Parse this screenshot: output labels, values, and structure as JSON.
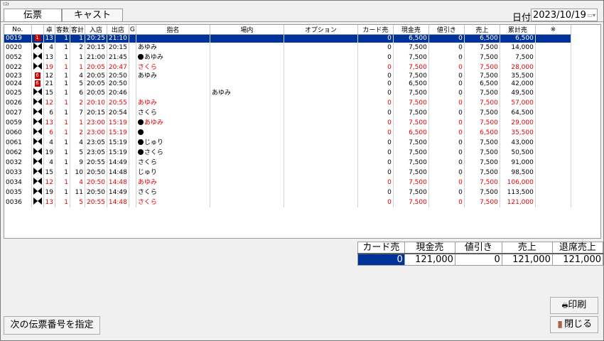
{
  "window": {
    "title": "ﾘｽﾄ"
  },
  "tabs": [
    {
      "label": "伝票"
    },
    {
      "label": "キャスト"
    }
  ],
  "date": {
    "label": "日付",
    "value": "2023/10/19",
    "dropdown_glyph": "▭▾"
  },
  "table": {
    "headers": [
      "No.",
      "",
      "卓",
      "客数",
      "客計",
      "入店",
      "出店",
      "G",
      "指名",
      "場内",
      "オプション",
      "カード売",
      "現金売",
      "値引き",
      "売上",
      "累計売",
      "※"
    ],
    "rows": [
      {
        "no": "0019",
        "tablenum": "13",
        "guests": "1",
        "total": "1",
        "in": "20:25",
        "out": "21:10",
        "g": "",
        "shimei": "",
        "jonai": "",
        "option": "",
        "card": "0",
        "cash": "6,500",
        "discount": "0",
        "sales": "6,500",
        "cumulative": "6,500",
        "note": "",
        "red": false,
        "selected": true,
        "flag": "1",
        "dot": false
      },
      {
        "no": "0020",
        "tablenum": "4",
        "guests": "1",
        "total": "2",
        "in": "20:15",
        "out": "20:15",
        "g": "",
        "shimei": "あゆみ",
        "jonai": "",
        "option": "",
        "card": "0",
        "cash": "7,500",
        "discount": "0",
        "sales": "7,500",
        "cumulative": "14,000",
        "note": "",
        "red": false,
        "selected": false,
        "flag": "",
        "dot": false
      },
      {
        "no": "0052",
        "tablenum": "13",
        "guests": "1",
        "total": "1",
        "in": "21:00",
        "out": "21:45",
        "g": "",
        "shimei": "あゆみ",
        "jonai": "",
        "option": "",
        "card": "0",
        "cash": "7,500",
        "discount": "0",
        "sales": "7,500",
        "cumulative": "7,500",
        "note": "",
        "red": false,
        "selected": false,
        "flag": "",
        "dot": true
      },
      {
        "no": "0022",
        "tablenum": "19",
        "guests": "1",
        "total": "1",
        "in": "20:05",
        "out": "20:47",
        "g": "",
        "shimei": "さくら",
        "jonai": "",
        "option": "",
        "card": "0",
        "cash": "7,500",
        "discount": "0",
        "sales": "7,500",
        "cumulative": "28,000",
        "note": "",
        "red": true,
        "selected": false,
        "flag": "",
        "dot": false
      },
      {
        "no": "0023",
        "tablenum": "12",
        "guests": "1",
        "total": "4",
        "in": "20:05",
        "out": "20:50",
        "g": "",
        "shimei": "あゆみ",
        "jonai": "",
        "option": "",
        "card": "0",
        "cash": "7,500",
        "discount": "0",
        "sales": "7,500",
        "cumulative": "35,500",
        "note": "",
        "red": false,
        "selected": false,
        "flag": "6",
        "dot": false
      },
      {
        "no": "0024",
        "tablenum": "21",
        "guests": "1",
        "total": "5",
        "in": "20:05",
        "out": "20:50",
        "g": "",
        "shimei": "",
        "jonai": "",
        "option": "",
        "card": "0",
        "cash": "6,500",
        "discount": "0",
        "sales": "6,500",
        "cumulative": "42,000",
        "note": "",
        "red": false,
        "selected": false,
        "flag": "6",
        "dot": false
      },
      {
        "no": "0025",
        "tablenum": "15",
        "guests": "1",
        "total": "6",
        "in": "20:05",
        "out": "20:46",
        "g": "",
        "shimei": "",
        "jonai": "あゆみ",
        "option": "",
        "card": "0",
        "cash": "7,500",
        "discount": "0",
        "sales": "7,500",
        "cumulative": "49,500",
        "note": "",
        "red": false,
        "selected": false,
        "flag": "",
        "dot": false
      },
      {
        "no": "0026",
        "tablenum": "12",
        "guests": "1",
        "total": "2",
        "in": "20:10",
        "out": "20:55",
        "g": "",
        "shimei": "あゆみ",
        "jonai": "",
        "option": "",
        "card": "0",
        "cash": "7,500",
        "discount": "0",
        "sales": "7,500",
        "cumulative": "57,000",
        "note": "",
        "red": true,
        "selected": false,
        "flag": "",
        "dot": false
      },
      {
        "no": "0027",
        "tablenum": "6",
        "guests": "1",
        "total": "7",
        "in": "20:15",
        "out": "20:54",
        "g": "",
        "shimei": "さくら",
        "jonai": "",
        "option": "",
        "card": "0",
        "cash": "7,500",
        "discount": "0",
        "sales": "7,500",
        "cumulative": "64,500",
        "note": "",
        "red": false,
        "selected": false,
        "flag": "",
        "dot": false
      },
      {
        "no": "0059",
        "tablenum": "13",
        "guests": "1",
        "total": "1",
        "in": "23:00",
        "out": "15:19",
        "g": "",
        "shimei": "あゆみ",
        "jonai": "",
        "option": "",
        "card": "0",
        "cash": "7,500",
        "discount": "0",
        "sales": "7,500",
        "cumulative": "29,000",
        "note": "",
        "red": true,
        "selected": false,
        "flag": "",
        "dot": true
      },
      {
        "no": "0060",
        "tablenum": "6",
        "guests": "1",
        "total": "2",
        "in": "23:00",
        "out": "15:19",
        "g": "",
        "shimei": "",
        "jonai": "",
        "option": "",
        "card": "0",
        "cash": "6,500",
        "discount": "0",
        "sales": "6,500",
        "cumulative": "35,500",
        "note": "",
        "red": true,
        "selected": false,
        "flag": "",
        "dot": true
      },
      {
        "no": "0061",
        "tablenum": "4",
        "guests": "1",
        "total": "4",
        "in": "23:05",
        "out": "15:19",
        "g": "",
        "shimei": "じゅり",
        "jonai": "",
        "option": "",
        "card": "0",
        "cash": "7,500",
        "discount": "0",
        "sales": "7,500",
        "cumulative": "43,000",
        "note": "",
        "red": false,
        "selected": false,
        "flag": "",
        "dot": true
      },
      {
        "no": "0062",
        "tablenum": "19",
        "guests": "1",
        "total": "5",
        "in": "23:05",
        "out": "15:19",
        "g": "",
        "shimei": "さくら",
        "jonai": "",
        "option": "",
        "card": "0",
        "cash": "7,500",
        "discount": "0",
        "sales": "7,500",
        "cumulative": "50,500",
        "note": "",
        "red": false,
        "selected": false,
        "flag": "",
        "dot": true
      },
      {
        "no": "0032",
        "tablenum": "4",
        "guests": "1",
        "total": "9",
        "in": "20:55",
        "out": "14:49",
        "g": "",
        "shimei": "さくら",
        "jonai": "",
        "option": "",
        "card": "0",
        "cash": "7,500",
        "discount": "0",
        "sales": "7,500",
        "cumulative": "91,000",
        "note": "",
        "red": false,
        "selected": false,
        "flag": "",
        "dot": false
      },
      {
        "no": "0033",
        "tablenum": "15",
        "guests": "1",
        "total": "10",
        "in": "20:50",
        "out": "14:48",
        "g": "",
        "shimei": "じゅり",
        "jonai": "",
        "option": "",
        "card": "0",
        "cash": "7,500",
        "discount": "0",
        "sales": "7,500",
        "cumulative": "98,500",
        "note": "",
        "red": false,
        "selected": false,
        "flag": "",
        "dot": false
      },
      {
        "no": "0034",
        "tablenum": "12",
        "guests": "1",
        "total": "4",
        "in": "20:50",
        "out": "14:48",
        "g": "",
        "shimei": "あゆみ",
        "jonai": "",
        "option": "",
        "card": "0",
        "cash": "7,500",
        "discount": "0",
        "sales": "7,500",
        "cumulative": "106,000",
        "note": "",
        "red": true,
        "selected": false,
        "flag": "",
        "dot": false
      },
      {
        "no": "0035",
        "tablenum": "19",
        "guests": "1",
        "total": "11",
        "in": "20:50",
        "out": "14:49",
        "g": "",
        "shimei": "さくら",
        "jonai": "",
        "option": "",
        "card": "0",
        "cash": "7,500",
        "discount": "0",
        "sales": "7,500",
        "cumulative": "113,500",
        "note": "",
        "red": false,
        "selected": false,
        "flag": "",
        "dot": false
      },
      {
        "no": "0036",
        "tablenum": "13",
        "guests": "1",
        "total": "5",
        "in": "20:55",
        "out": "14:48",
        "g": "",
        "shimei": "さくら",
        "jonai": "",
        "option": "",
        "card": "0",
        "cash": "7,500",
        "discount": "0",
        "sales": "7,500",
        "cumulative": "121,000",
        "note": "",
        "red": true,
        "selected": false,
        "flag": "",
        "dot": false
      }
    ]
  },
  "summary": {
    "headers": [
      "カード売",
      "現金売",
      "値引き",
      "売上",
      "退席売上"
    ],
    "values": [
      "0",
      "121,000",
      "0",
      "121,000",
      "121,000"
    ]
  },
  "buttons": {
    "print": "印刷",
    "close": "閉じる",
    "next_slip": "次の伝票番号を指定",
    "print_icon": "printer-icon",
    "close_icon": "door-icon"
  },
  "colors": {
    "selected_row": "#003399",
    "red_text": "#e00000"
  }
}
